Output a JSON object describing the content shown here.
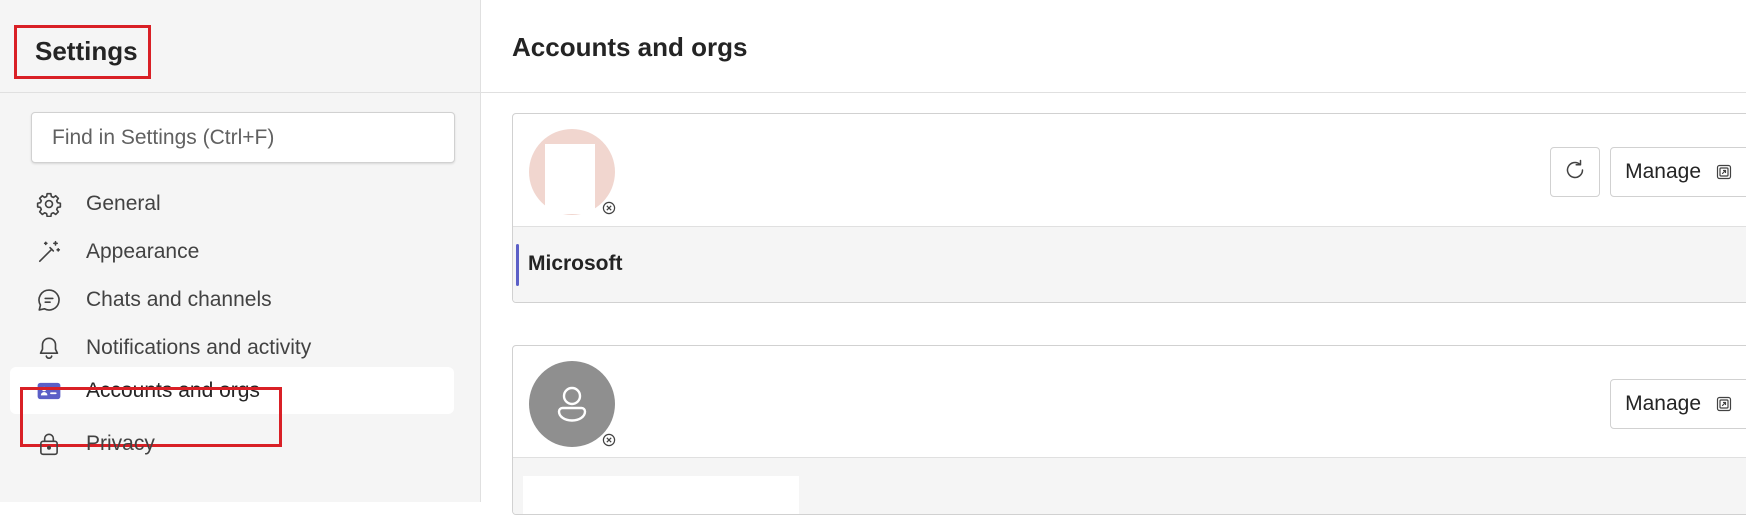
{
  "sidebar": {
    "title": "Settings",
    "search": {
      "placeholder": "Find in Settings (Ctrl+F)",
      "value": ""
    },
    "items": [
      {
        "label": "General",
        "icon": "gear-icon",
        "active": false
      },
      {
        "label": "Appearance",
        "icon": "magic-wand-icon",
        "active": false
      },
      {
        "label": "Chats and channels",
        "icon": "chat-bubble-icon",
        "active": false
      },
      {
        "label": "Notifications and activity",
        "icon": "bell-icon",
        "active": false
      },
      {
        "label": "Accounts and orgs",
        "icon": "id-card-icon",
        "active": true
      },
      {
        "label": "Privacy",
        "icon": "lock-icon",
        "active": false
      }
    ]
  },
  "main": {
    "title": "Accounts and orgs",
    "accounts": [
      {
        "avatar_icon": "avatar-icon",
        "status_icon": "offline-status-icon",
        "refresh_icon": "refresh-icon",
        "manage_label": "Manage",
        "manage_icon": "open-external-icon",
        "org_name": "Microsoft"
      },
      {
        "avatar_icon": "person-icon",
        "status_icon": "offline-status-icon",
        "manage_label": "Manage",
        "manage_icon": "open-external-icon"
      }
    ]
  },
  "colors": {
    "accent": "#5b5fc7",
    "highlight_box": "#d92026",
    "sidebar_bg": "#f5f5f5",
    "avatar1_bg": "#f1d6cf",
    "avatar2_bg": "#8f8f8f"
  }
}
